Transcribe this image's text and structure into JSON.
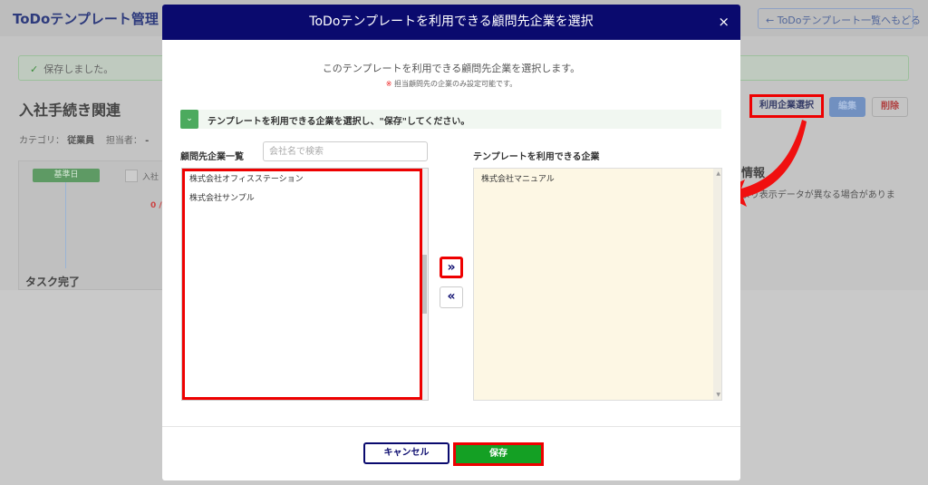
{
  "background": {
    "app_title": "ToDoテンプレート管理",
    "back_button": "← ToDoテンプレート一覧へもどる",
    "saved_message": "保存しました。",
    "template_name": "入社手続き関連",
    "category_label": "カテゴリ：",
    "category_value": "従業員",
    "assignee_label": "担当者：",
    "assignee_value": "-",
    "base_date": "基準日",
    "checkbox_label": "入社",
    "progress": "0 /",
    "task_done": "タスク完了",
    "right_heading": "情報",
    "right_sub": "より表示データが異なる場合がありま",
    "select_companies_button": "利用企業選択",
    "edit_button": "編集",
    "delete_button": "削除"
  },
  "modal": {
    "title": "ToDoテンプレートを利用できる顧問先企業を選択",
    "close": "×",
    "description": "このテンプレートを利用できる顧問先企業を選択します。",
    "note_mark": "※",
    "note": "担当顧問先の企業のみ設定可能です。",
    "hint": "テンプレートを利用できる企業を選択し、\"保存\"してください。",
    "left_label": "顧問先企業一覧",
    "search_placeholder": "会社名で検索",
    "left_items": [
      "株式会社オフィスステーション",
      "株式会社サンプル"
    ],
    "right_label": "テンプレートを利用できる企業",
    "right_items": [
      "株式会社マニュアル"
    ],
    "add_button": "»",
    "remove_button": "«",
    "cancel_button": "キャンセル",
    "save_button": "保存"
  }
}
